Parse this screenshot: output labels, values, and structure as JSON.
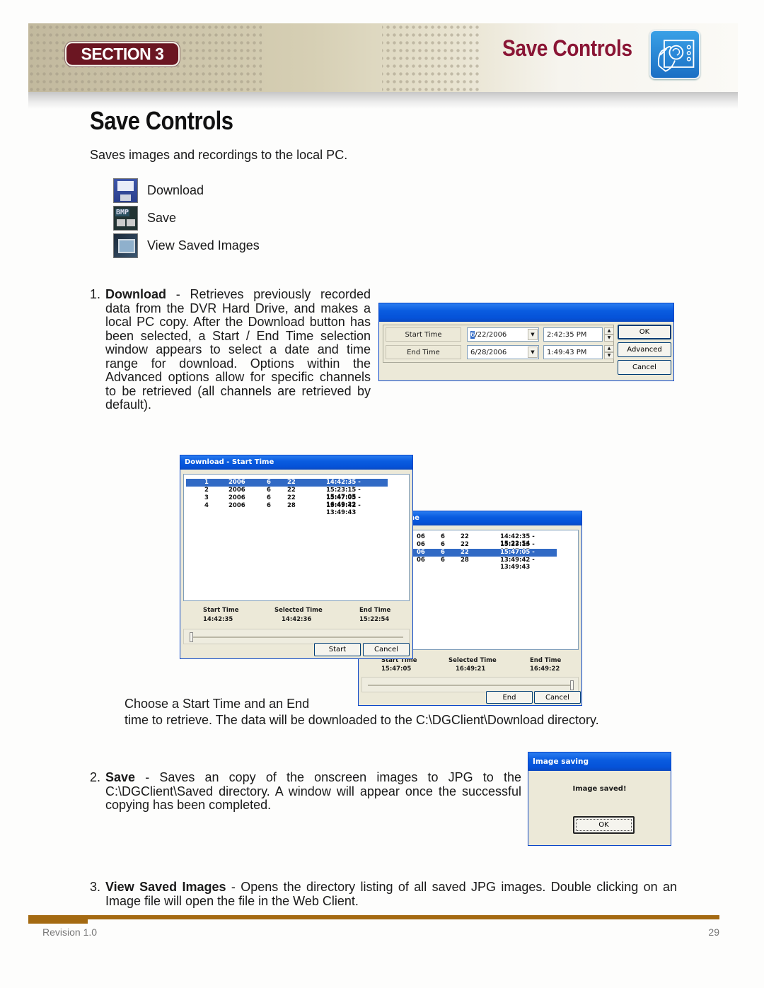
{
  "header": {
    "section_label": "SECTION 3",
    "title": "Save Controls",
    "icon": "hand-control-icon"
  },
  "page": {
    "title": "Save Controls",
    "intro": "Saves images and recordings to the local PC."
  },
  "legend": [
    {
      "icon": "floppy-download-icon",
      "label": "Download"
    },
    {
      "icon": "bmp-save-icon",
      "label": "Save"
    },
    {
      "icon": "view-images-icon",
      "label": "View Saved Images"
    }
  ],
  "items": [
    {
      "num": "1.",
      "term": "Download",
      "text": " - Retrieves previously recorded data from the DVR Hard Drive, and makes a local PC copy. After the Download button has been selected, a Start / End Time selection window appears to select a date and time range for download. Options within the Advanced options allow for specific channels to be retrieved (all channels are retrieved by default)."
    },
    {
      "num": "2.",
      "term": "Save",
      "text": " - Saves an copy of the onscreen images to JPG to the C:\\DGClient\\Saved directory. A window will appear once the successful copying has been completed."
    },
    {
      "num": "3.",
      "term": "View Saved Images",
      "text": " - Opens the directory listing of all saved JPG images. Double clicking on an Image file will open the file in the Web Client."
    }
  ],
  "choose_text": {
    "line1": "Choose a Start Time and an End",
    "line2": "time to retrieve. The data will be downloaded to the C:\\DGClient\\Download directory."
  },
  "date_dialog": {
    "start_label": "Start Time",
    "start_date_first": "6",
    "start_date_rest": "/22/2006",
    "start_time": "2:42:35 PM",
    "end_label": "End Time",
    "end_date": "6/28/2006",
    "end_time": "1:49:43 PM",
    "ok": "OK",
    "advanced": "Advanced",
    "cancel": "Cancel"
  },
  "download_start": {
    "title": "Download - Start Time",
    "rows": [
      {
        "no": "1",
        "year": "2006",
        "month": "6",
        "day": "22",
        "range": "14:42:35 - 15:22:54",
        "selected": true
      },
      {
        "no": "2",
        "year": "2006",
        "month": "6",
        "day": "22",
        "range": "15:23:15 - 15:47:05",
        "selected": false
      },
      {
        "no": "3",
        "year": "2006",
        "month": "6",
        "day": "22",
        "range": "15:47:05 - 16:49:22",
        "selected": false
      },
      {
        "no": "4",
        "year": "2006",
        "month": "6",
        "day": "28",
        "range": "13:49:42 - 13:49:43",
        "selected": false
      }
    ],
    "start_time_label": "Start Time",
    "start_time": "14:42:35",
    "selected_time_label": "Selected Time",
    "selected_time": "14:42:36",
    "end_time_label": "End Time",
    "end_time": "15:22:54",
    "slider_position": 0.0,
    "start_button": "Start",
    "cancel_button": "Cancel"
  },
  "download_end": {
    "title_fragment": "ne",
    "rows": [
      {
        "year": "06",
        "month": "6",
        "day": "22",
        "range": "14:42:35 - 15:22:54",
        "selected": false
      },
      {
        "year": "06",
        "month": "6",
        "day": "22",
        "range": "15:23:15 - 15:47:05",
        "selected": false
      },
      {
        "year": "06",
        "month": "6",
        "day": "22",
        "range": "15:47:05 - 16:49:22",
        "selected": true
      },
      {
        "year": "06",
        "month": "6",
        "day": "28",
        "range": "13:49:42 - 13:49:43",
        "selected": false
      }
    ],
    "start_time_label": "Start Time",
    "start_time": "15:47:05",
    "selected_time_label": "Selected Time",
    "selected_time": "16:49:21",
    "end_time_label": "End Time",
    "end_time": "16:49:22",
    "slider_position": 1.0,
    "end_button": "End",
    "cancel_button": "Cancel"
  },
  "image_saving": {
    "title": "Image saving",
    "message": "Image saved!",
    "ok": "OK"
  },
  "footer": {
    "revision": "Revision 1.0",
    "page_number": "29"
  }
}
